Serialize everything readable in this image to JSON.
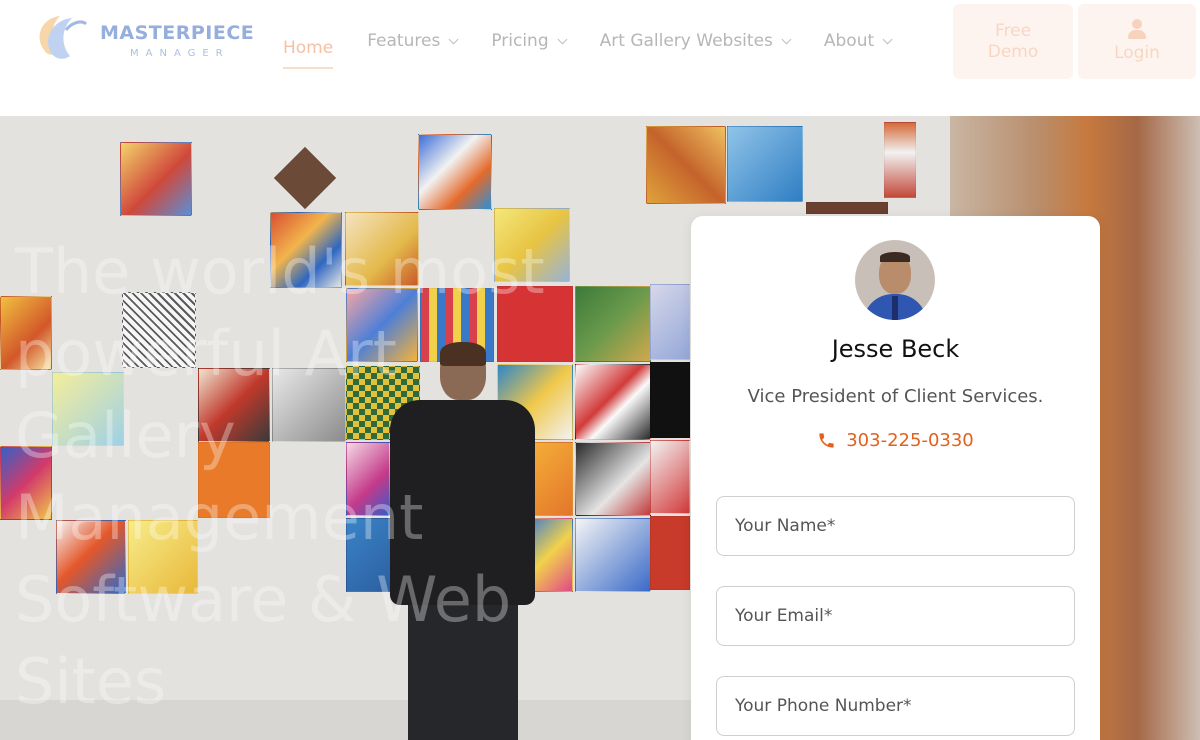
{
  "header": {
    "logo": {
      "brand": "MASTERPIECE",
      "sub": "MANAGER"
    },
    "nav": [
      {
        "label": "Home",
        "active": true,
        "dropdown": false
      },
      {
        "label": "Features",
        "active": false,
        "dropdown": true
      },
      {
        "label": "Pricing",
        "active": false,
        "dropdown": true
      },
      {
        "label": "Art Gallery Websites",
        "active": false,
        "dropdown": true
      },
      {
        "label": "About",
        "active": false,
        "dropdown": true
      }
    ],
    "demo_button": {
      "line1": "Free",
      "line2": "Demo"
    },
    "login_button": {
      "label": "Login",
      "icon": "user-icon"
    }
  },
  "hero": {
    "headline": "The world's most powerful Art Gallery Management Software & Web Sites"
  },
  "contact_card": {
    "name": "Jesse Beck",
    "role": "Vice President of Client Services.",
    "phone": "303-225-0330",
    "phone_icon": "phone-icon",
    "fields": [
      {
        "placeholder": "Your Name*"
      },
      {
        "placeholder": "Your Email*"
      },
      {
        "placeholder": "Your Phone Number*"
      }
    ]
  },
  "colors": {
    "accent": "#e2611e",
    "nav_active": "#f2a980",
    "button_bg": "#fdf1ea"
  }
}
